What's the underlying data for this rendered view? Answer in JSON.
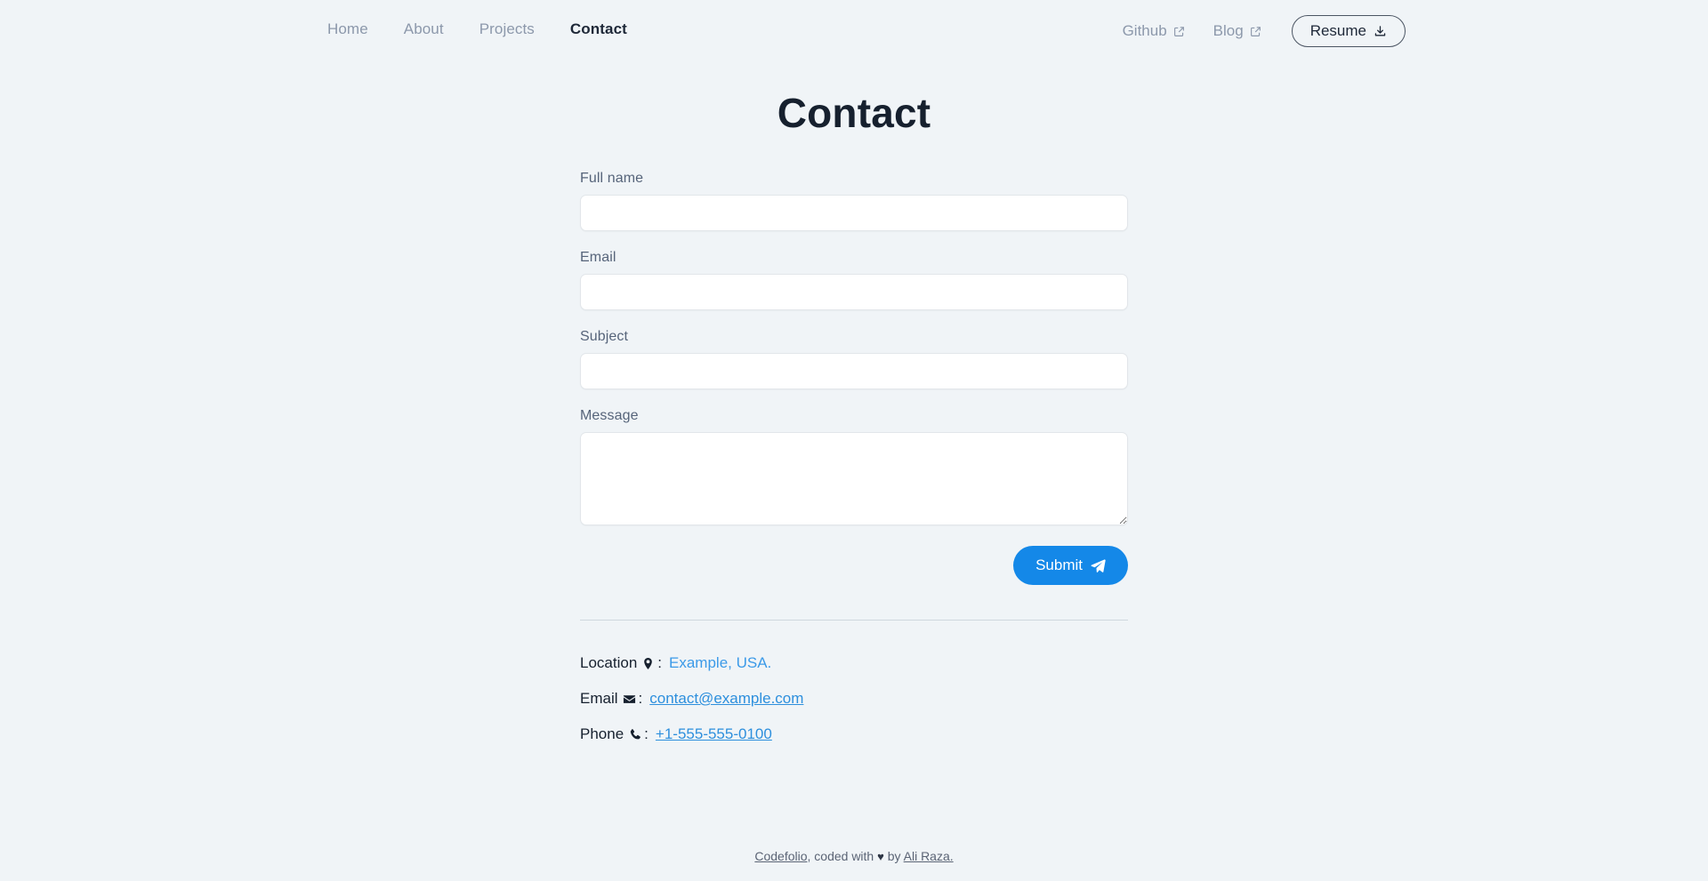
{
  "nav": {
    "links": [
      {
        "label": "Home",
        "active": false
      },
      {
        "label": "About",
        "active": false
      },
      {
        "label": "Projects",
        "active": false
      },
      {
        "label": "Contact",
        "active": true
      }
    ],
    "external": [
      {
        "label": "Github",
        "icon": "external-link-icon"
      },
      {
        "label": "Blog",
        "icon": "external-link-icon"
      }
    ],
    "resume": {
      "label": "Resume",
      "icon": "download-icon"
    }
  },
  "page": {
    "title": "Contact"
  },
  "form": {
    "fields": [
      {
        "label": "Full name",
        "value": "",
        "placeholder": "",
        "type": "text"
      },
      {
        "label": "Email",
        "value": "",
        "placeholder": "",
        "type": "email"
      },
      {
        "label": "Subject",
        "value": "",
        "placeholder": "",
        "type": "text"
      },
      {
        "label": "Message",
        "value": "",
        "placeholder": "",
        "type": "textarea"
      }
    ],
    "submit": {
      "label": "Submit",
      "icon": "paper-plane-icon"
    }
  },
  "contact_info": [
    {
      "label": "Location",
      "icon": "map-pin-icon",
      "separator": ":",
      "value": "Example, USA.",
      "underlined": false
    },
    {
      "label": "Email",
      "icon": "envelope-icon",
      "separator": ":",
      "value": "contact@example.com",
      "underlined": true
    },
    {
      "label": "Phone",
      "icon": "phone-icon",
      "separator": ":",
      "value": "+1-555-555-0100",
      "underlined": true
    }
  ],
  "footer": {
    "brand": "Codefolio",
    "mid_text": ", coded with ",
    "heart": "♥",
    "by_text": " by ",
    "author": "Ali Raza."
  },
  "colors": {
    "background": "#f0f4f7",
    "accent": "#1488e8",
    "link": "#3b9ae8",
    "muted_text": "#8c98ab",
    "heading": "#16202e"
  }
}
